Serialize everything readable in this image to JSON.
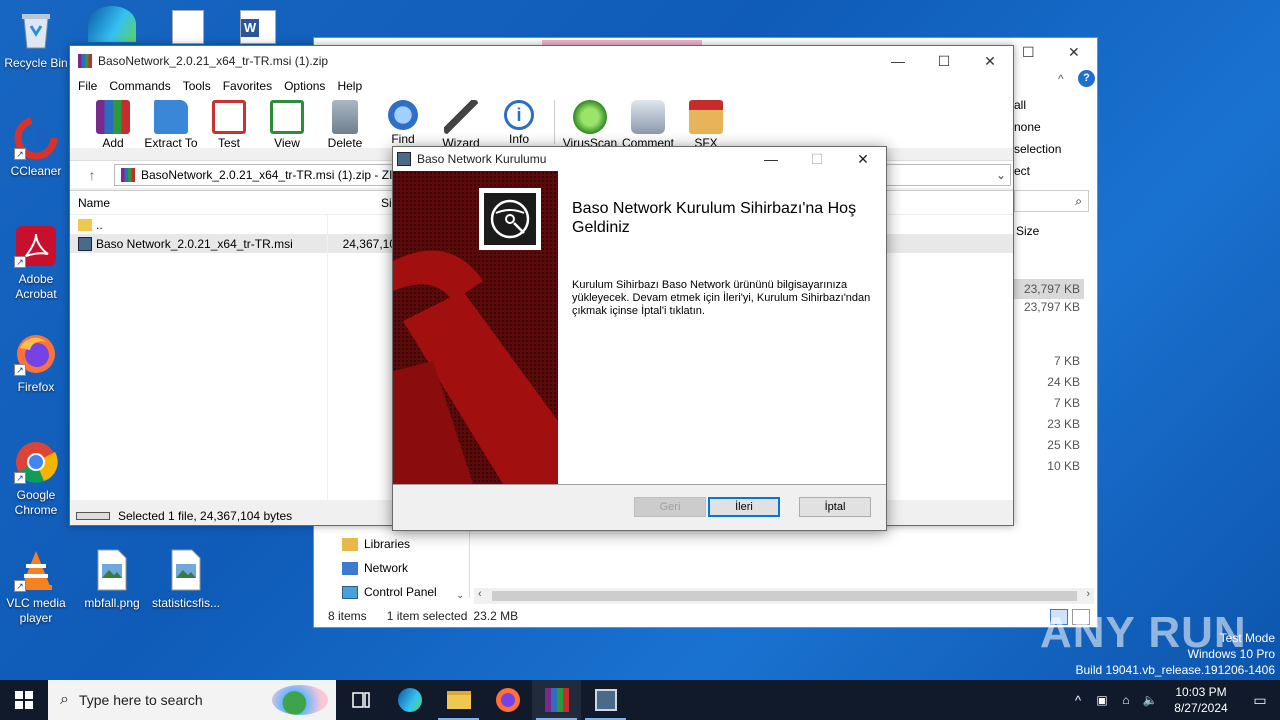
{
  "desktop": {
    "icons": [
      {
        "label": "Recycle Bin",
        "icon": "recycle-bin-icon"
      },
      {
        "label": "CCleaner",
        "icon": "ccleaner-icon"
      },
      {
        "label": "Adobe Acrobat",
        "icon": "adobe-acrobat-icon"
      },
      {
        "label": "Firefox",
        "icon": "firefox-icon"
      },
      {
        "label": "Google Chrome",
        "icon": "chrome-icon"
      },
      {
        "label": "VLC media player",
        "icon": "vlc-icon"
      },
      {
        "label": "mbfall.png",
        "icon": "image-file-icon"
      },
      {
        "label": "statisticsfis...",
        "icon": "image-file-icon"
      }
    ]
  },
  "explorer": {
    "right_labels": [
      "all",
      "none",
      "selection",
      "ect"
    ],
    "size_header": "Size",
    "sizes": [
      "23,797 KB",
      "23,797 KB",
      "7 KB",
      "24 KB",
      "7 KB",
      "23 KB",
      "25 KB",
      "10 KB"
    ],
    "sidebar": [
      {
        "label": "Libraries",
        "icon": "libraries-icon"
      },
      {
        "label": "Network",
        "icon": "network-icon"
      },
      {
        "label": "Control Panel",
        "icon": "control-panel-icon"
      }
    ],
    "status": {
      "items": "8 items",
      "selected": "1 item selected",
      "size": "23.2 MB"
    }
  },
  "winrar": {
    "title": "BasoNetwork_2.0.21_x64_tr-TR.msi (1).zip",
    "menu": [
      "File",
      "Commands",
      "Tools",
      "Favorites",
      "Options",
      "Help"
    ],
    "toolbar": [
      {
        "label": "Add",
        "icon": "add-archive-icon",
        "color": "#c0392b"
      },
      {
        "label": "Extract To",
        "icon": "extract-folder-icon",
        "color": "#3a87d8"
      },
      {
        "label": "Test",
        "icon": "test-clipboard-icon",
        "color": "#c83232"
      },
      {
        "label": "View",
        "icon": "view-book-icon",
        "color": "#2e8b3a"
      },
      {
        "label": "Delete",
        "icon": "delete-trash-icon",
        "color": "#8a9aa8"
      },
      {
        "label": "Find",
        "icon": "find-magnifier-icon",
        "color": "#2f6fc8"
      },
      {
        "label": "Wizard",
        "icon": "wizard-wand-icon",
        "color": "#6a6aa8"
      },
      {
        "label": "Info",
        "icon": "info-icon",
        "color": "#2a6fc0"
      },
      {
        "label": "VirusScan",
        "icon": "virusscan-bug-icon",
        "color": "#3aa82e"
      },
      {
        "label": "Comment",
        "icon": "comment-icon",
        "color": "#7a8a9a"
      },
      {
        "label": "SFX",
        "icon": "sfx-box-icon",
        "color": "#d88a2a"
      }
    ],
    "address": "BasoNetwork_2.0.21_x64_tr-TR.msi (1).zip - ZIP",
    "columns": {
      "name": "Name",
      "size": "Size"
    },
    "rows": [
      {
        "name": "..",
        "size": "",
        "icon": "folder-icon"
      },
      {
        "name": "Baso Network_2.0.21_x64_tr-TR.msi",
        "size": "24,367,10",
        "icon": "msi-file-icon"
      }
    ],
    "status": "Selected 1 file, 24,367,104 bytes"
  },
  "installer": {
    "title": "Baso Network Kurulumu",
    "heading": "Baso Network Kurulum Sihirbazı'na Hoş Geldiniz",
    "body": "Kurulum Sihirbazı Baso Network ürününü bilgisayarınıza yükleyecek. Devam etmek için İleri'yi, Kurulum Sihirbazı'ndan çıkmak içinse İptal'i tıklatın.",
    "buttons": {
      "back": "Geri",
      "next": "İleri",
      "cancel": "İptal"
    },
    "banner_color": "#5c0a0a"
  },
  "taskbar": {
    "search_placeholder": "Type here to search",
    "time": "10:03 PM",
    "date": "8/27/2024"
  },
  "watermark": {
    "brand": "ANY RUN",
    "mode": "Test Mode",
    "os": "Windows 10 Pro",
    "build": "Build 19041.vb_release.191206-1406"
  }
}
